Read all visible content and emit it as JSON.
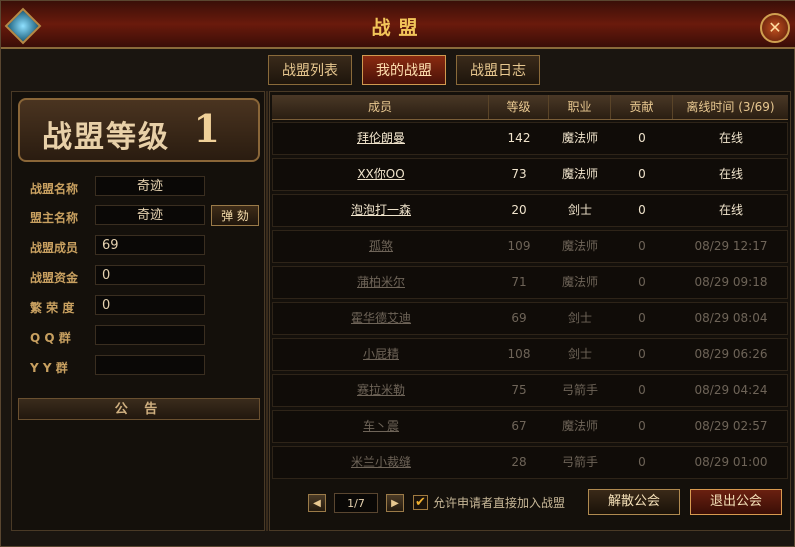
{
  "window": {
    "title": "战盟",
    "close_label": "✕"
  },
  "tabs": [
    {
      "label": "战盟列表",
      "active": false
    },
    {
      "label": "我的战盟",
      "active": true
    },
    {
      "label": "战盟日志",
      "active": false
    }
  ],
  "guild": {
    "level_label": "战盟等级",
    "level_value": "1",
    "fields": {
      "name": {
        "label": "战盟名称",
        "value": "奇迹"
      },
      "leader": {
        "label": "盟主名称",
        "value": "奇迹"
      },
      "members": {
        "label": "战盟成员",
        "value": "69"
      },
      "funds": {
        "label": "战盟资金",
        "value": "0"
      },
      "prosperity": {
        "label": "繁 荣 度",
        "value": "0"
      },
      "qq": {
        "label": "Q Q  群",
        "value": ""
      },
      "yy": {
        "label": "Y Y  群",
        "value": ""
      }
    },
    "impeach_label": "弹 劾",
    "notice_label": "公 告"
  },
  "table": {
    "headers": [
      "成员",
      "等级",
      "职业",
      "贡献",
      "离线时间 (3/69)"
    ],
    "rows": [
      {
        "name": "拜伦朗曼",
        "level": "142",
        "class": "魔法师",
        "contrib": "0",
        "time": "在线",
        "online": true
      },
      {
        "name": "XX你OO",
        "level": "73",
        "class": "魔法师",
        "contrib": "0",
        "time": "在线",
        "online": true
      },
      {
        "name": "泡泡打一森",
        "level": "20",
        "class": "剑士",
        "contrib": "0",
        "time": "在线",
        "online": true
      },
      {
        "name": "孤煞",
        "level": "109",
        "class": "魔法师",
        "contrib": "0",
        "time": "08/29 12:17",
        "online": false
      },
      {
        "name": "蒲柏米尔",
        "level": "71",
        "class": "魔法师",
        "contrib": "0",
        "time": "08/29 09:18",
        "online": false
      },
      {
        "name": "霍华德艾迪",
        "level": "69",
        "class": "剑士",
        "contrib": "0",
        "time": "08/29 08:04",
        "online": false
      },
      {
        "name": "小屁精",
        "level": "108",
        "class": "剑士",
        "contrib": "0",
        "time": "08/29 06:26",
        "online": false
      },
      {
        "name": "赛拉米勒",
        "level": "75",
        "class": "弓箭手",
        "contrib": "0",
        "time": "08/29 04:24",
        "online": false
      },
      {
        "name": "车丶震",
        "level": "67",
        "class": "魔法师",
        "contrib": "0",
        "time": "08/29 02:57",
        "online": false
      },
      {
        "name": "米兰小裁缝",
        "level": "28",
        "class": "弓箭手",
        "contrib": "0",
        "time": "08/29 01:00",
        "online": false
      }
    ]
  },
  "footer": {
    "prev_label": "◀",
    "next_label": "▶",
    "page": "1/7",
    "checkbox_checked": true,
    "checkbox_mark": "✔",
    "checkbox_label": "允许申请者直接加入战盟",
    "disband_label": "解散公会",
    "leave_label": "退出公会"
  },
  "colors": {
    "accent": "#f2c55a",
    "online_text": "#f0e4cc",
    "offline_text": "#6e6458"
  }
}
